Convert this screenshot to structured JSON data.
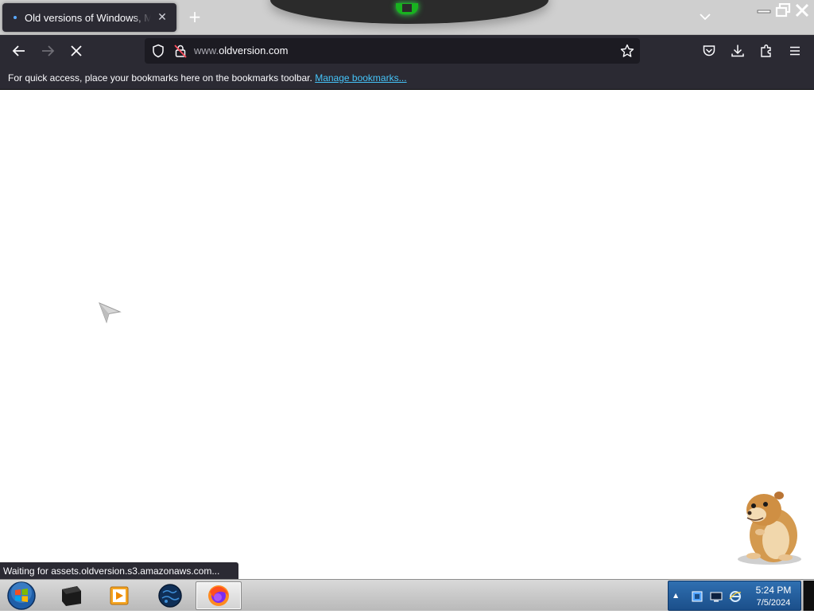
{
  "browser": {
    "tab": {
      "title": "Old versions of Windows, Mac",
      "close_icon": "close-icon"
    },
    "new_tab_icon": "plus-icon",
    "tab_list_icon": "chevron-down-icon",
    "window_controls": [
      "minimize-icon",
      "restore-icon",
      "close-icon"
    ],
    "nav": {
      "back_icon": "arrow-left-icon",
      "forward_icon": "arrow-right-icon",
      "stop_icon": "x-icon"
    },
    "url": {
      "prefix": "www.",
      "domain": "oldversion.com"
    },
    "toolbar_icons": [
      "pocket-icon",
      "download-icon",
      "extensions-icon",
      "hamburger-menu-icon"
    ],
    "bookmarks_toolbar": {
      "message": "For quick access, place your bookmarks here on the bookmarks toolbar.",
      "link_label": "Manage bookmarks..."
    },
    "status_text": "Waiting for assets.oldversion.s3.amazonaws.com..."
  },
  "taskbar": {
    "items": [
      "start-orb-icon",
      "terminal-icon",
      "media-player-icon",
      "globe-icon",
      "firefox-icon"
    ],
    "active_item": "firefox-icon",
    "tray": {
      "icons": [
        "network-icon",
        "monitor-icon",
        "internet-explorer-icon"
      ],
      "time": "5:24 PM",
      "date": "7/5/2024"
    }
  },
  "colors": {
    "browser_chrome": "#2b2a33",
    "urlbar_bg": "#1c1b22",
    "link": "#45c4f9",
    "tray_blue": "#1b4f8a",
    "wallpaper_green": "#18b31f"
  }
}
